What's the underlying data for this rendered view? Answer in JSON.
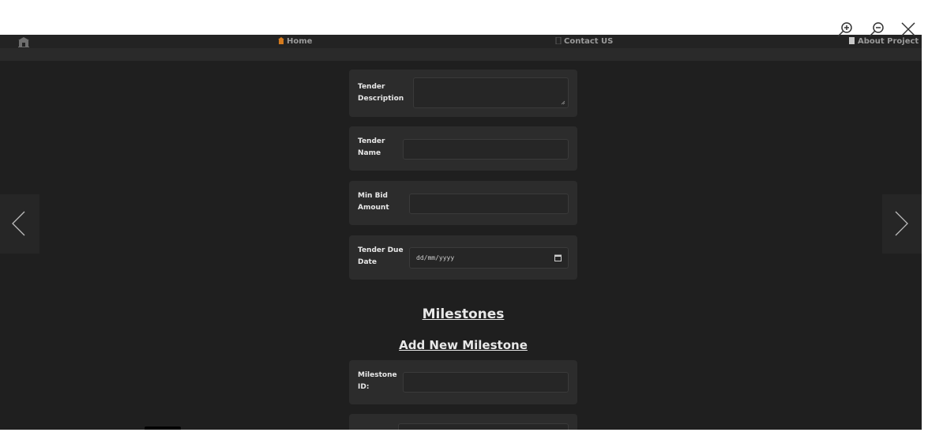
{
  "navbar": {
    "home_label": "Home",
    "contact_label": "Contact US",
    "about_label": "About Project"
  },
  "form": {
    "tender_description_label": "Tender Description",
    "tender_name_label": "Tender Name",
    "min_bid_label": "Min Bid Amount",
    "due_date_label": "Tender Due Date",
    "due_date_placeholder": "dd/mm/yyyy"
  },
  "milestones": {
    "title": "Milestones",
    "add_new": "Add New Milestone",
    "milestone_id_label": "Milestone ID:"
  },
  "colors": {
    "page_bg": "#1f1f1f",
    "card_bg": "#2c2c2c",
    "field_bg": "#262626",
    "text": "#e8e8e8"
  },
  "icons": [
    "zoom-in-icon",
    "zoom-out-icon",
    "close-icon",
    "home-icon",
    "chevron-left-icon",
    "chevron-right-icon",
    "calendar-icon"
  ]
}
